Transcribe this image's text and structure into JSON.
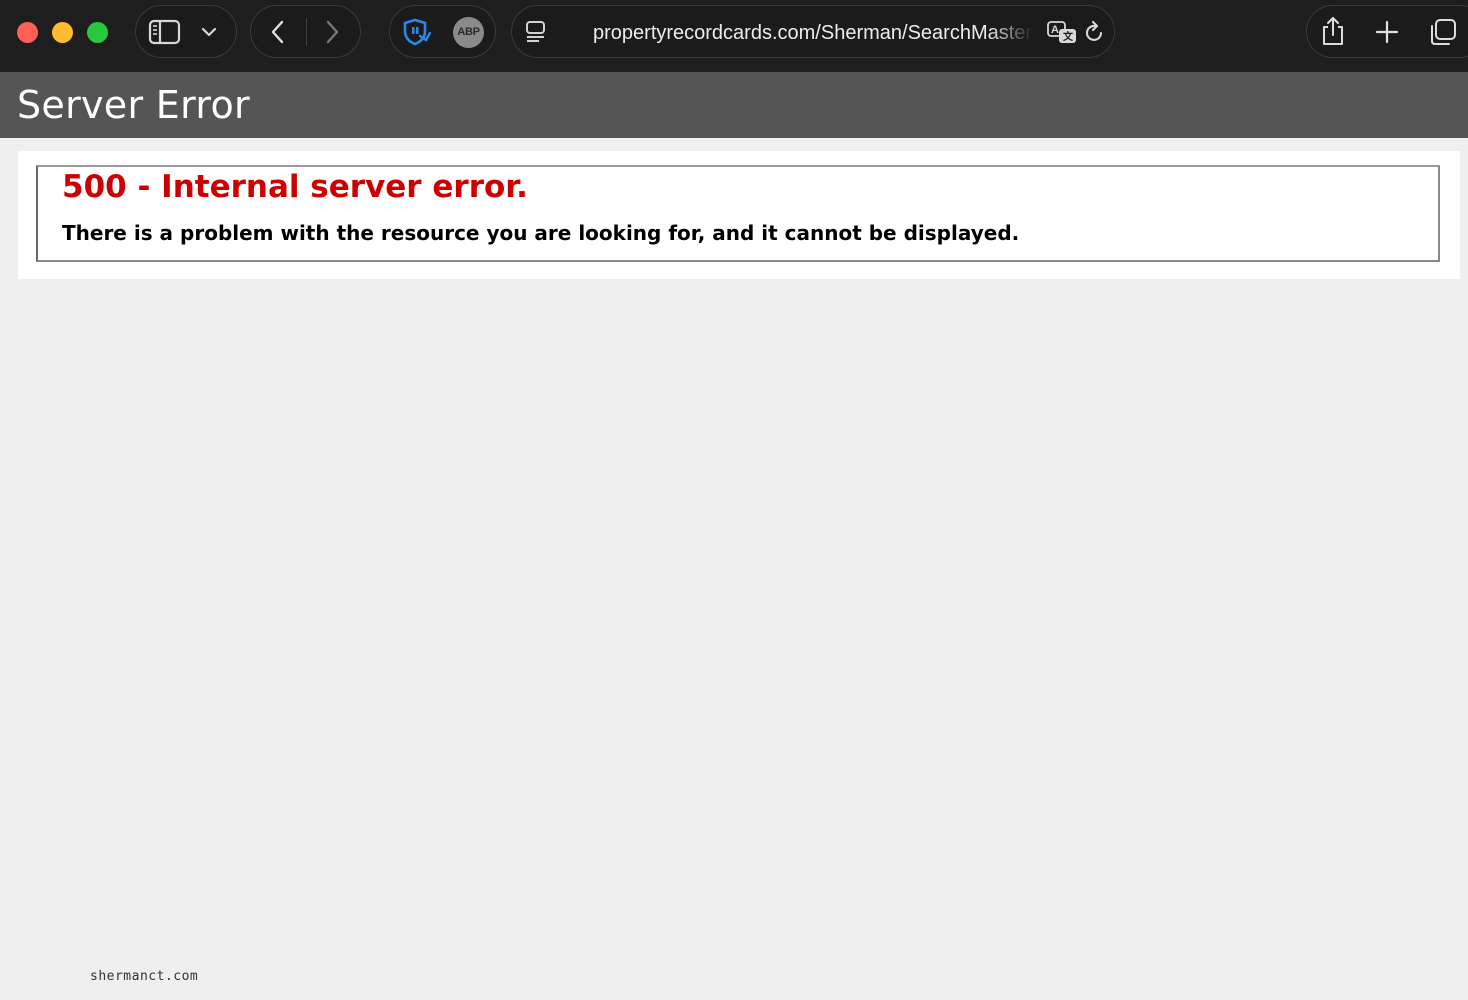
{
  "browser": {
    "url": "propertyrecordcards.com/Sherman/SearchMaster.aspx",
    "extensions": {
      "abp_label": "ABP"
    },
    "icons": {
      "sidebar": "sidebar-icon",
      "tab_menu": "chevron-down-icon",
      "back": "chevron-left-icon",
      "forward": "chevron-right-icon",
      "shield_extension": "shield-extension-icon",
      "abp": "adblock-plus-icon",
      "page_menu": "page-menu-icon",
      "translate": "translate-icon",
      "reload": "reload-icon",
      "share": "share-icon",
      "new_tab": "plus-icon",
      "tab_overview": "tab-overview-icon"
    }
  },
  "page": {
    "title": "Server Error",
    "error_code": "500 - Internal server error.",
    "error_message": "There is a problem with the resource you are looking for, and it cannot be displayed.",
    "watermark": "shermanct.com"
  },
  "colors": {
    "header_bg": "#555555",
    "error_red": "#cc0000",
    "page_bg": "#efefef",
    "toolbar_bg": "#1e1e1e"
  }
}
